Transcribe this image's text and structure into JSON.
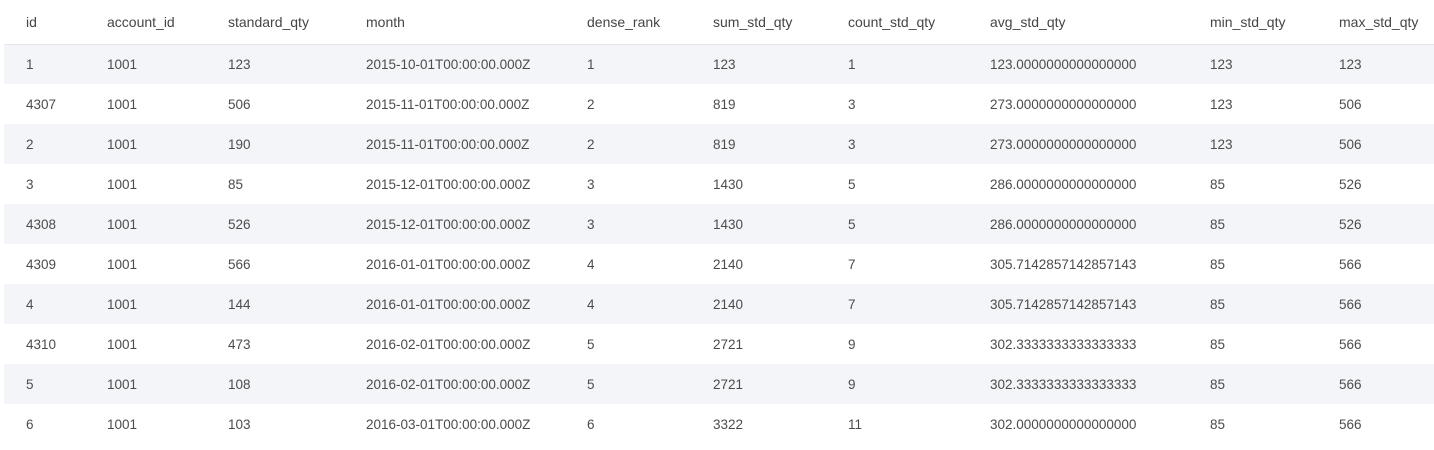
{
  "table": {
    "columns": [
      "id",
      "account_id",
      "standard_qty",
      "month",
      "dense_rank",
      "sum_std_qty",
      "count_std_qty",
      "avg_std_qty",
      "min_std_qty",
      "max_std_qty"
    ],
    "rows": [
      [
        "1",
        "1001",
        "123",
        "2015-10-01T00:00:00.000Z",
        "1",
        "123",
        "1",
        "123.0000000000000000",
        "123",
        "123"
      ],
      [
        "4307",
        "1001",
        "506",
        "2015-11-01T00:00:00.000Z",
        "2",
        "819",
        "3",
        "273.0000000000000000",
        "123",
        "506"
      ],
      [
        "2",
        "1001",
        "190",
        "2015-11-01T00:00:00.000Z",
        "2",
        "819",
        "3",
        "273.0000000000000000",
        "123",
        "506"
      ],
      [
        "3",
        "1001",
        "85",
        "2015-12-01T00:00:00.000Z",
        "3",
        "1430",
        "5",
        "286.0000000000000000",
        "85",
        "526"
      ],
      [
        "4308",
        "1001",
        "526",
        "2015-12-01T00:00:00.000Z",
        "3",
        "1430",
        "5",
        "286.0000000000000000",
        "85",
        "526"
      ],
      [
        "4309",
        "1001",
        "566",
        "2016-01-01T00:00:00.000Z",
        "4",
        "2140",
        "7",
        "305.7142857142857143",
        "85",
        "566"
      ],
      [
        "4",
        "1001",
        "144",
        "2016-01-01T00:00:00.000Z",
        "4",
        "2140",
        "7",
        "305.7142857142857143",
        "85",
        "566"
      ],
      [
        "4310",
        "1001",
        "473",
        "2016-02-01T00:00:00.000Z",
        "5",
        "2721",
        "9",
        "302.3333333333333333",
        "85",
        "566"
      ],
      [
        "5",
        "1001",
        "108",
        "2016-02-01T00:00:00.000Z",
        "5",
        "2721",
        "9",
        "302.3333333333333333",
        "85",
        "566"
      ],
      [
        "6",
        "1001",
        "103",
        "2016-03-01T00:00:00.000Z",
        "6",
        "3322",
        "11",
        "302.0000000000000000",
        "85",
        "566"
      ]
    ]
  },
  "colors": {
    "stripe": "#f3f5f8",
    "text": "#4c4c4c",
    "border": "#e4e6ea"
  }
}
